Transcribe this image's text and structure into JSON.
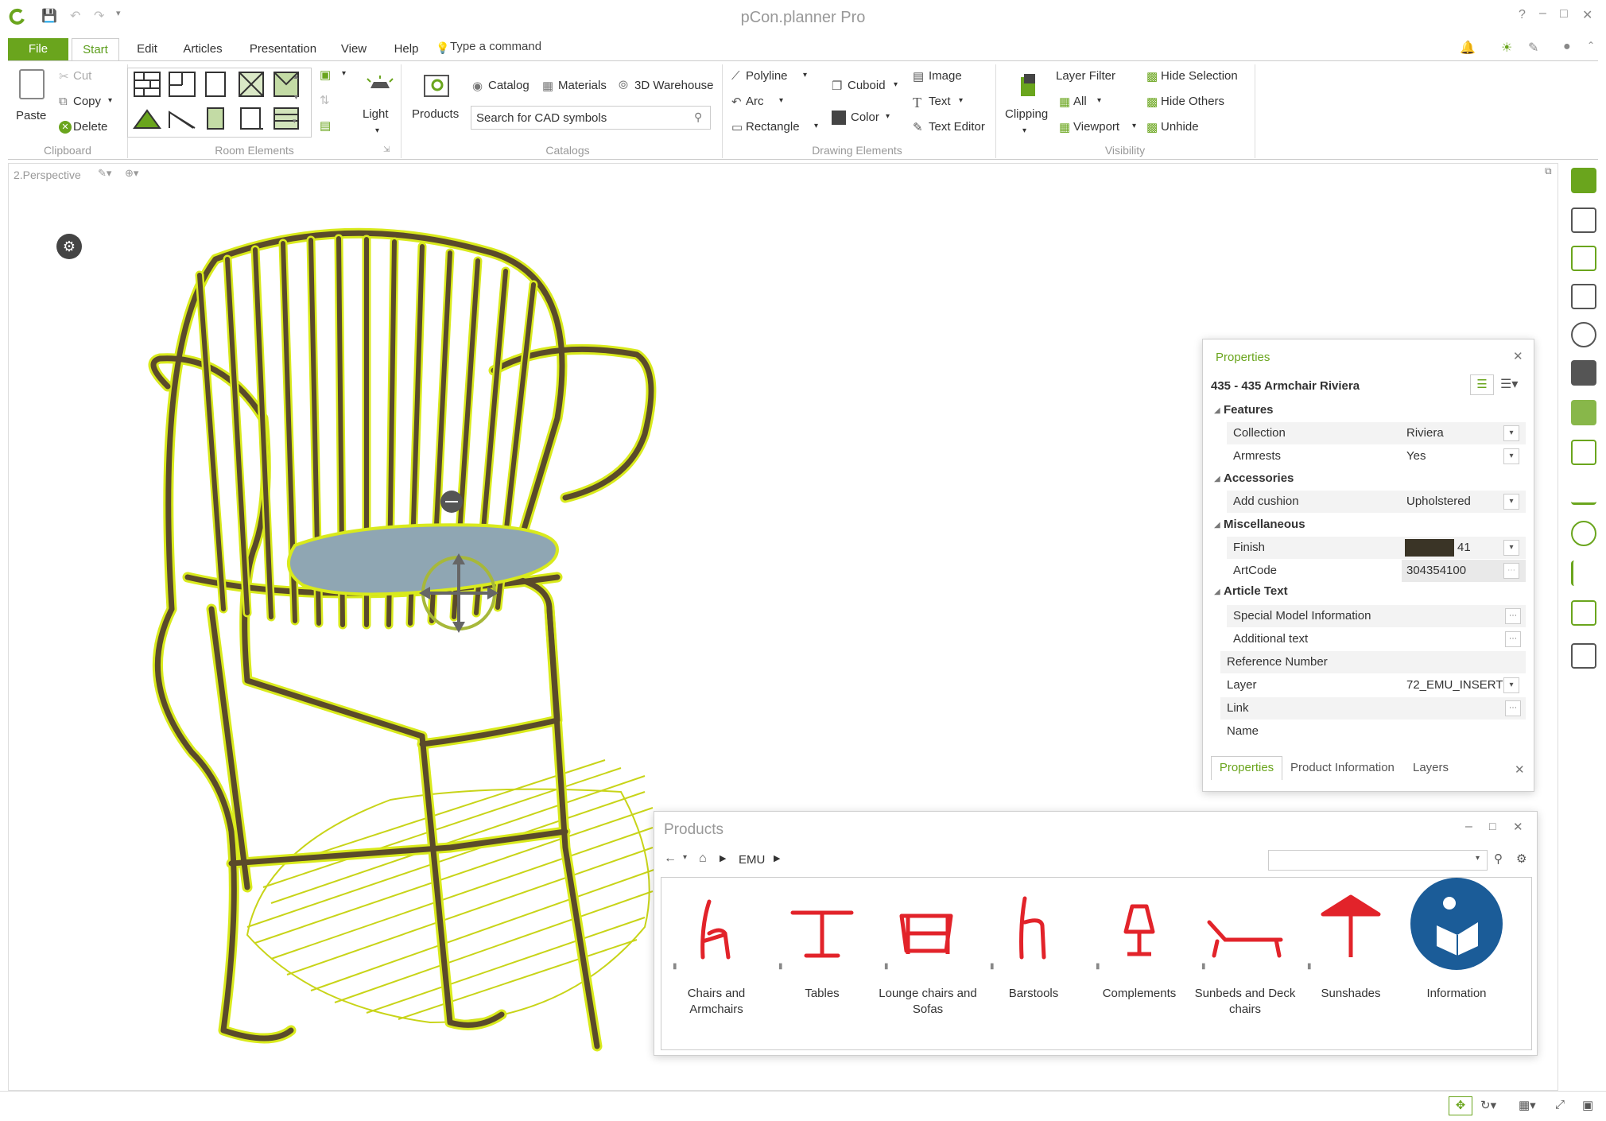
{
  "window": {
    "title": "pCon.planner Pro"
  },
  "tabs": [
    {
      "label": "File"
    },
    {
      "label": "Start"
    },
    {
      "label": "Edit"
    },
    {
      "label": "Articles"
    },
    {
      "label": "Presentation"
    },
    {
      "label": "View"
    },
    {
      "label": "Help"
    }
  ],
  "command_placeholder": "Type a command",
  "ribbon": {
    "clipboard": {
      "paste": "Paste",
      "cut": "Cut",
      "copy": "Copy",
      "delete": "Delete",
      "group": "Clipboard"
    },
    "room_elements": {
      "group": "Room Elements"
    },
    "light": "Light",
    "products": "Products",
    "catalogs": {
      "catalog": "Catalog",
      "materials": "Materials",
      "warehouse": "3D Warehouse",
      "search_placeholder": "Search for CAD symbols",
      "group": "Catalogs"
    },
    "drawing": {
      "polyline": "Polyline",
      "arc": "Arc",
      "rectangle": "Rectangle",
      "cuboid": "Cuboid",
      "color": "Color",
      "image": "Image",
      "text": "Text",
      "text_editor": "Text Editor",
      "group": "Drawing Elements"
    },
    "visibility": {
      "clipping": "Clipping",
      "layer_filter": "Layer Filter",
      "all": "All",
      "viewport": "Viewport",
      "hide_selection": "Hide Selection",
      "hide_others": "Hide Others",
      "unhide": "Unhide",
      "group": "Visibility"
    }
  },
  "viewport": {
    "label": "2.Perspective"
  },
  "properties": {
    "title": "Properties",
    "object": "435 - 435 Armchair Riviera",
    "sections": {
      "features": "Features",
      "accessories": "Accessories",
      "misc": "Miscellaneous",
      "article_text": "Article Text"
    },
    "rows": {
      "collection": {
        "label": "Collection",
        "value": "Riviera"
      },
      "armrests": {
        "label": "Armrests",
        "value": "Yes"
      },
      "add_cushion": {
        "label": "Add cushion",
        "value": "Upholstered"
      },
      "finish": {
        "label": "Finish",
        "value": "41"
      },
      "artcode": {
        "label": "ArtCode",
        "value": "304354100"
      },
      "special": {
        "label": "Special Model Information",
        "value": ""
      },
      "additional": {
        "label": "Additional text",
        "value": ""
      },
      "reference": {
        "label": "Reference Number",
        "value": ""
      },
      "layer": {
        "label": "Layer",
        "value": "72_EMU_INSERT"
      },
      "link": {
        "label": "Link",
        "value": ""
      },
      "name": {
        "label": "Name",
        "value": ""
      }
    },
    "tabs": {
      "properties": "Properties",
      "product_info": "Product Information",
      "layers": "Layers"
    }
  },
  "products": {
    "title": "Products",
    "breadcrumb": "EMU",
    "items": [
      {
        "label1": "Chairs and",
        "label2": "Armchairs"
      },
      {
        "label1": "Tables",
        "label2": ""
      },
      {
        "label1": "Lounge chairs and",
        "label2": "Sofas"
      },
      {
        "label1": "Barstools",
        "label2": ""
      },
      {
        "label1": "Complements",
        "label2": ""
      },
      {
        "label1": "Sunbeds and Deck",
        "label2": "chairs"
      },
      {
        "label1": "Sunshades",
        "label2": ""
      },
      {
        "label1": "Information",
        "label2": ""
      }
    ]
  },
  "colors": {
    "accent": "#6aa51d",
    "chair": "#5a4a2a",
    "outline": "#d9ea1c",
    "cushion": "#8fa6b3",
    "icon_red": "#e2232a",
    "info_blue": "#1b5c98"
  }
}
